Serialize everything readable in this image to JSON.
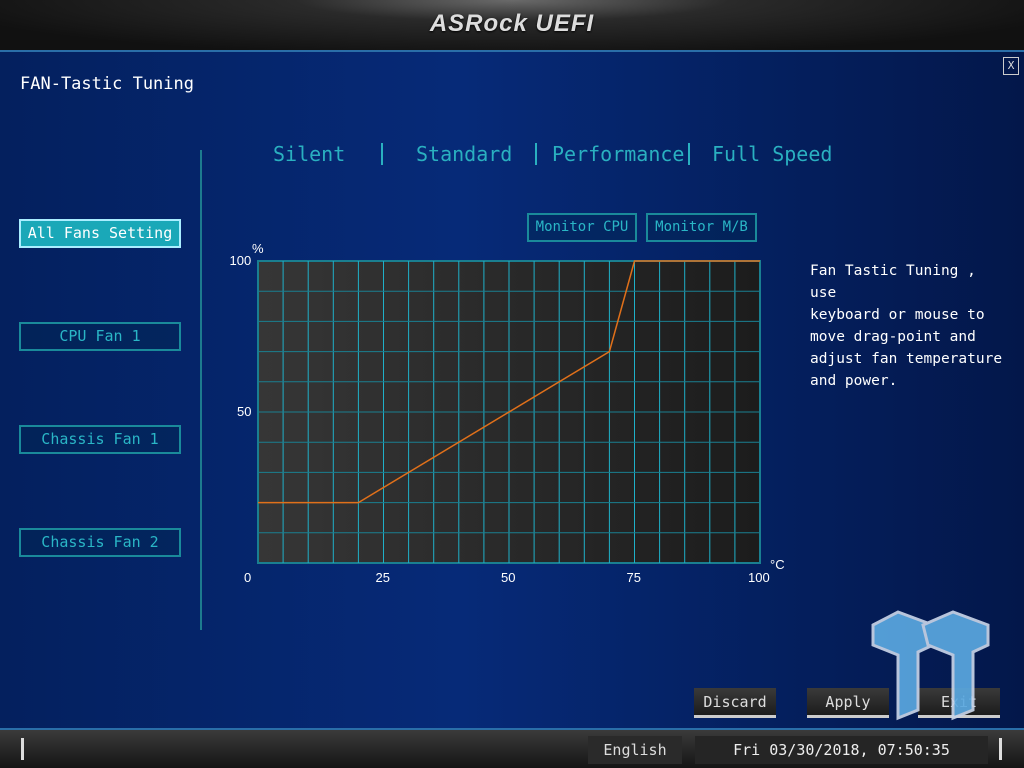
{
  "header": {
    "logo": "ASRock UEFI"
  },
  "page": {
    "title": "FAN-Tastic Tuning",
    "close_label": "X"
  },
  "modes": [
    "Silent",
    "Standard",
    "Performance",
    "Full Speed"
  ],
  "fans": [
    {
      "label": "All Fans Setting",
      "active": true
    },
    {
      "label": "CPU Fan 1"
    },
    {
      "label": "Chassis Fan 1"
    },
    {
      "label": "Chassis Fan 2"
    }
  ],
  "monitor": {
    "cpu": "Monitor CPU",
    "mb": "Monitor M/B"
  },
  "help": "Fan Tastic Tuning , use\nkeyboard or mouse to\nmove drag-point and\nadjust fan temperature\nand power.",
  "chart_data": {
    "type": "line",
    "ylabel": "%",
    "xlabel": "°C",
    "xlim": [
      0,
      100
    ],
    "ylim": [
      0,
      100
    ],
    "xticks": [
      "0",
      "25",
      "50",
      "75",
      "100"
    ],
    "yticks": [
      "0",
      "50",
      "100"
    ],
    "grid": true,
    "x": [
      0,
      20,
      70,
      75,
      100
    ],
    "y": [
      20,
      20,
      70,
      100,
      100
    ],
    "line_color": "#e0701a",
    "grid_color": "#1fb0c8"
  },
  "actions": {
    "discard": "Discard",
    "apply": "Apply",
    "exit": "Exit"
  },
  "status": {
    "language": "English",
    "datetime": "Fri 03/30/2018, 07:50:35"
  }
}
